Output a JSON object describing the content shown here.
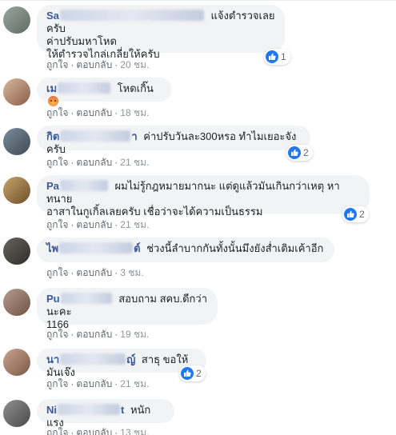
{
  "action_like": "ถูกใจ",
  "action_reply": "ตอบกลับ",
  "dot": "·",
  "comments": [
    {
      "name_start": "Sa",
      "name_end": "",
      "text_lines": [
        "แจ้งตำรวจเลยครับ",
        "ค่าปรับมหาโหด",
        "ให้ตำรวจไกล่เกลี่ยให้ครับ"
      ],
      "time": "20 ชม.",
      "likes": "1"
    },
    {
      "name_start": "เม",
      "name_end": "",
      "text_lines": [
        "โหดเกิ๊น"
      ],
      "time": "18 ชม.",
      "likes": ""
    },
    {
      "name_start": "กิต",
      "name_end": "า",
      "text_lines": [
        "ค่าปรับวันละ300หรอ ทำไมเยอะจังครับ"
      ],
      "time": "21 ชม.",
      "likes": "2"
    },
    {
      "name_start": "Pa",
      "name_end": "",
      "text_lines": [
        "ผมไม่รู้กฎหมายมากนะ แต่ดูแล้วมันเกินกว่าเหตุ หาทนาย",
        "อาสาในกูเกิ้ลเลยครับ เชื่อว่าจะได้ความเป็นธรรม"
      ],
      "time": "21 ชม.",
      "likes": "2"
    },
    {
      "name_start": "ไพ",
      "name_end": "ต์",
      "text_lines": [
        "ช่วงนี้ลำบากกันทั้งนั้นมึงยังส่ำเติมเค้าอีก"
      ],
      "time": "3 ชม.",
      "likes": ""
    },
    {
      "name_start": "Pu",
      "name_end": "",
      "text_lines": [
        "สอบถาม สคบ.ดีกว่านะคะ",
        "1166"
      ],
      "time": "19 ชม.",
      "likes": ""
    },
    {
      "name_start": "นา",
      "name_end": "ญ์",
      "text_lines": [
        "สาธุ ขอให้มันเจ๊ง"
      ],
      "time": "21 ชม.",
      "likes": "2"
    },
    {
      "name_start": "Ni",
      "name_end": "t",
      "text_lines": [
        "หนักแรง"
      ],
      "time": "13 ชม.",
      "likes": ""
    }
  ],
  "colors": {
    "name": "#385898",
    "bubble": "#f2f3f5",
    "like_blue": "#2078f4",
    "meta_text": "#616770"
  },
  "icons": [
    "like-icon",
    "angry-emoji-icon"
  ]
}
